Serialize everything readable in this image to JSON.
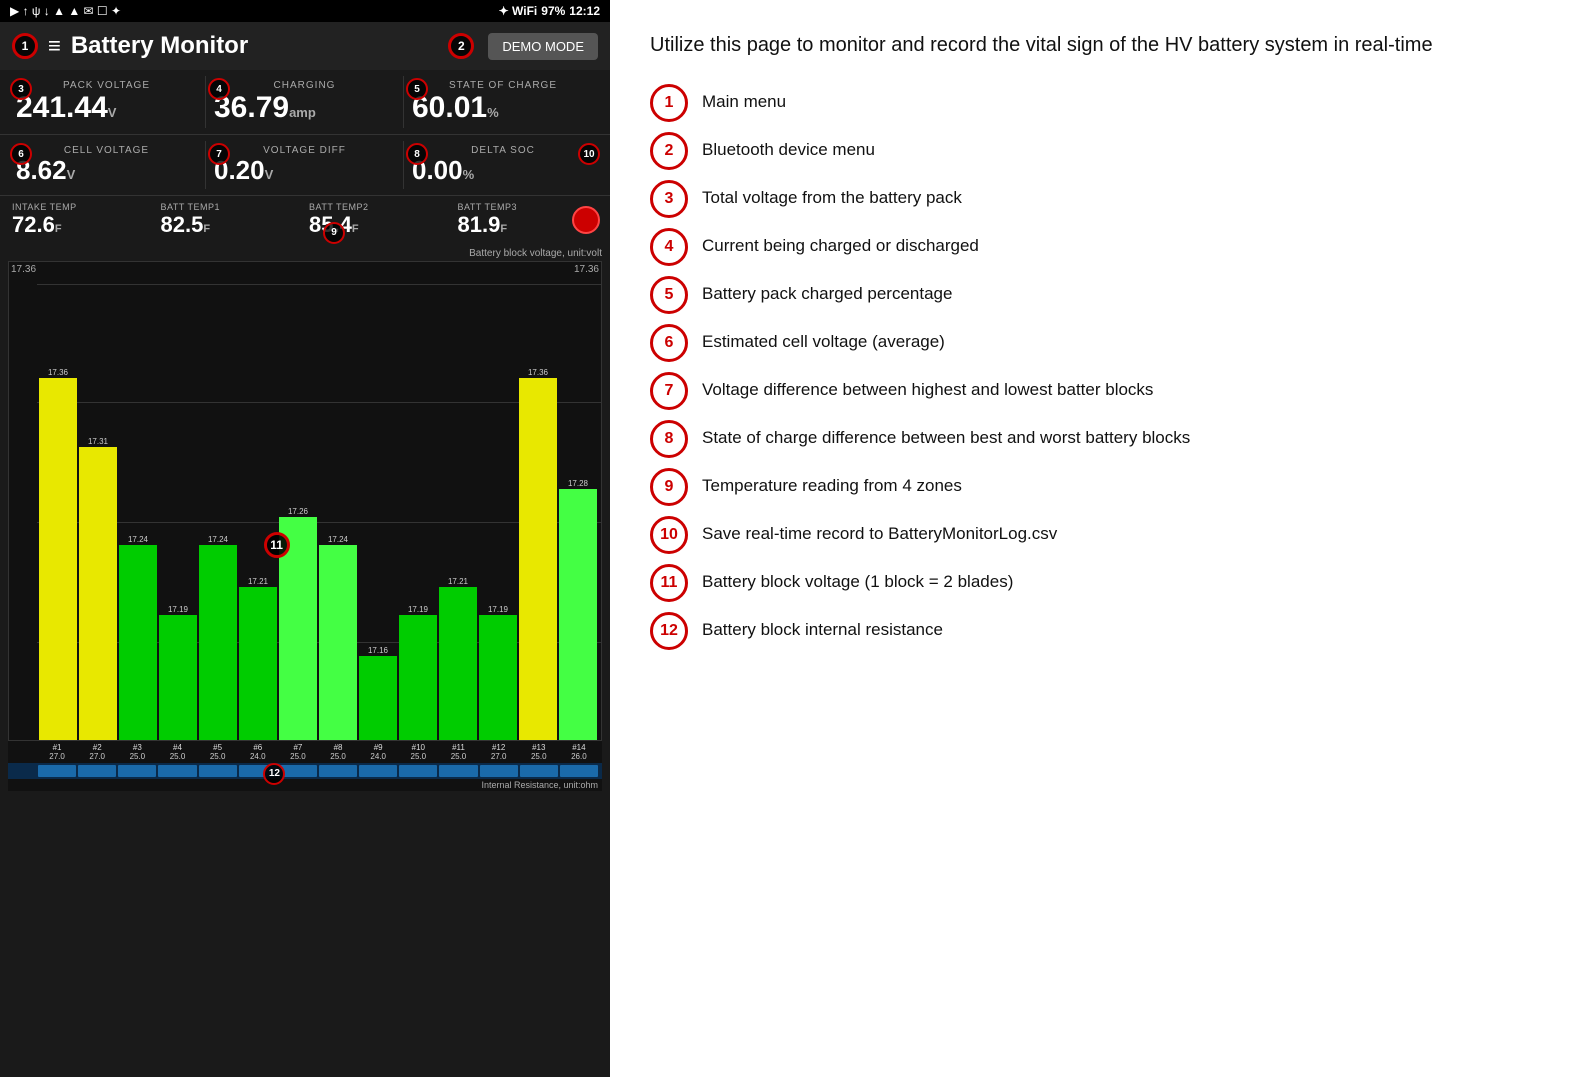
{
  "statusBar": {
    "leftIcons": "▶ ↑ ψ ↓ ▲ ▲ ✉ ☐ ✦",
    "rightIcons": "✦ WiFi",
    "battery": "97%",
    "time": "12:12"
  },
  "header": {
    "title": "Battery Monitor",
    "demoBtn": "DEMO MODE",
    "menuIcon": "≡"
  },
  "metrics": {
    "packVoltage": {
      "label": "PACK VOLTAGE",
      "value": "241.44",
      "unit": "V"
    },
    "charging": {
      "label": "CHARGING",
      "value": "36.79",
      "unit": "amp"
    },
    "stateOfCharge": {
      "label": "STATE OF CHARGE",
      "value": "60.01",
      "unit": "%"
    },
    "cellVoltage": {
      "label": "CELL VOLTAGE",
      "value": "8.62",
      "unit": "V"
    },
    "voltageDiff": {
      "label": "VOLTAGE DIFF",
      "value": "0.20",
      "unit": "V"
    },
    "deltaSoc": {
      "label": "DELTA SOC",
      "value": "0.00",
      "unit": "%"
    }
  },
  "temps": {
    "intake": {
      "label": "INTAKE TEMP",
      "value": "72.6",
      "unit": "F"
    },
    "batt1": {
      "label": "BATT TEMP1",
      "value": "82.5",
      "unit": "F"
    },
    "batt2": {
      "label": "BATT TEMP2",
      "value": "85.4",
      "unit": "F"
    },
    "batt3": {
      "label": "BATT TEMP3",
      "value": "81.9",
      "unit": "F"
    }
  },
  "chart": {
    "label": "Battery block voltage, unit:volt",
    "yMax": "17.36",
    "yMaxRight": "17.36",
    "bars": [
      {
        "id": "#1",
        "value": 17.36,
        "resistance": 27.0,
        "color": "yellow"
      },
      {
        "id": "#2",
        "value": 17.31,
        "resistance": 27.0,
        "color": "yellow"
      },
      {
        "id": "#3",
        "value": 17.24,
        "resistance": 25.0,
        "color": "green"
      },
      {
        "id": "#4",
        "value": 17.19,
        "resistance": 25.0,
        "color": "green"
      },
      {
        "id": "#5",
        "value": 17.24,
        "resistance": 25.0,
        "color": "green"
      },
      {
        "id": "#6",
        "value": 17.21,
        "resistance": 24.0,
        "color": "green"
      },
      {
        "id": "#7",
        "value": 17.26,
        "resistance": 25.0,
        "color": "bright-green"
      },
      {
        "id": "#8",
        "value": 17.24,
        "resistance": 25.0,
        "color": "bright-green"
      },
      {
        "id": "#9",
        "value": 17.16,
        "resistance": 24.0,
        "color": "green"
      },
      {
        "id": "#10",
        "value": 17.19,
        "resistance": 25.0,
        "color": "green"
      },
      {
        "id": "#11",
        "value": 17.21,
        "resistance": 25.0,
        "color": "green"
      },
      {
        "id": "#12",
        "value": 17.19,
        "resistance": 27.0,
        "color": "green"
      },
      {
        "id": "#13",
        "value": 17.36,
        "resistance": 25.0,
        "color": "yellow"
      },
      {
        "id": "#14",
        "value": 17.28,
        "resistance": 26.0,
        "color": "bright-green"
      }
    ],
    "resistanceLabel": "Internal Resistance, unit:ohm"
  },
  "descriptions": {
    "intro": "Utilize this page to monitor and record the vital sign of the HV battery system in real-time",
    "items": [
      {
        "num": "1",
        "text": "Main menu"
      },
      {
        "num": "2",
        "text": "Bluetooth device menu"
      },
      {
        "num": "3",
        "text": "Total voltage from the battery pack"
      },
      {
        "num": "4",
        "text": "Current being charged or discharged"
      },
      {
        "num": "5",
        "text": "Battery pack charged percentage"
      },
      {
        "num": "6",
        "text": "Estimated cell voltage (average)"
      },
      {
        "num": "7",
        "text": "Voltage difference between highest and lowest batter blocks"
      },
      {
        "num": "8",
        "text": "State of charge difference between best and worst battery blocks"
      },
      {
        "num": "9",
        "text": "Temperature reading from 4 zones"
      },
      {
        "num": "10",
        "text": "Save real-time record to BatteryMonitorLog.csv"
      },
      {
        "num": "11",
        "text": "Battery block voltage (1 block = 2 blades)"
      },
      {
        "num": "12",
        "text": "Battery block internal resistance"
      }
    ]
  }
}
